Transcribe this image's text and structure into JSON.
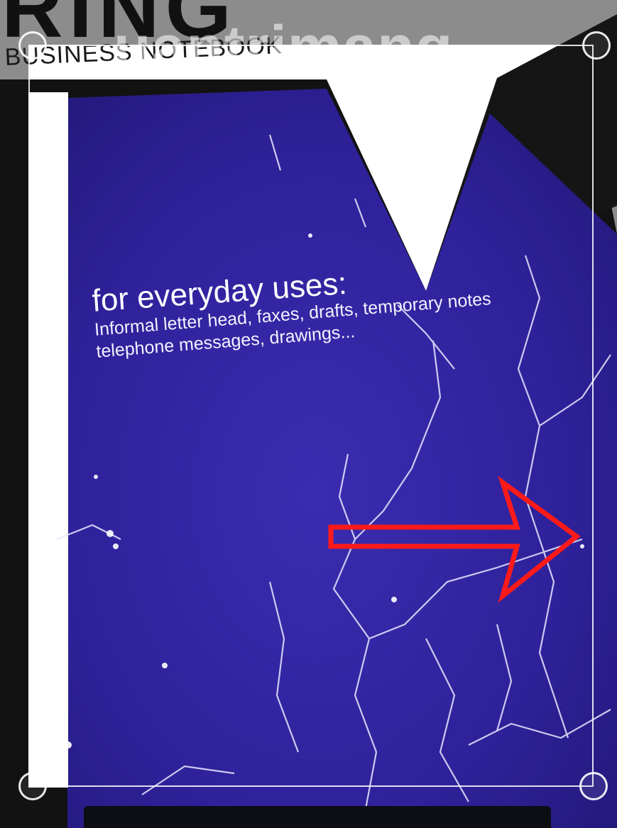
{
  "photo": {
    "brand_text": "RING",
    "subtitle": "BUSINESS NOTEBOOK",
    "heading": "for everyday uses:",
    "body_lines": [
      "Informal letter head, faxes, drafts, temporary notes",
      "telephone messages, drawings..."
    ],
    "cover_color": "#3a2aa8",
    "watermark": "uantrimang"
  },
  "crop_tool": {
    "frame_color": "#ffffff",
    "dim_color": "#8c8c8c",
    "handles": [
      "top-left",
      "top-right",
      "bottom-left",
      "bottom-right"
    ]
  },
  "annotation": {
    "arrow_color": "#ff1a1a",
    "direction": "right"
  }
}
